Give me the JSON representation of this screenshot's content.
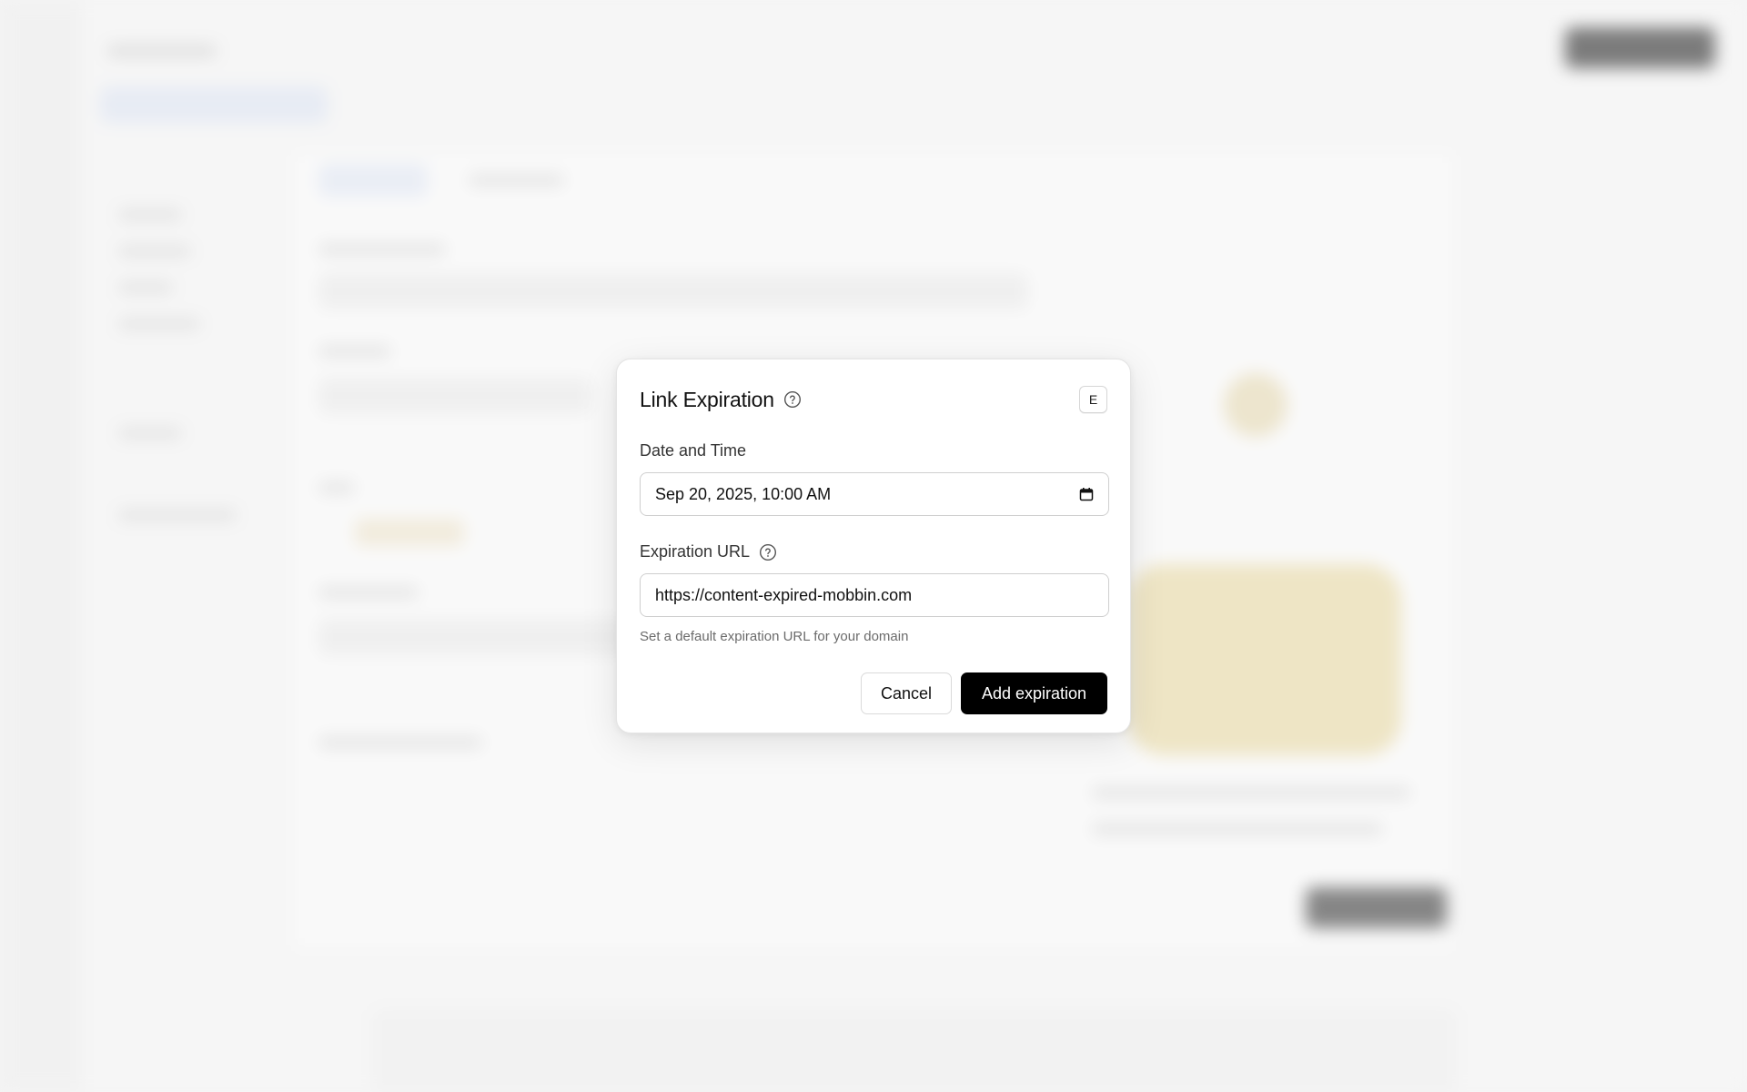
{
  "modal": {
    "title": "Link Expiration",
    "shortcut_key": "E",
    "date_field": {
      "label": "Date and Time",
      "value": "Sep 20, 2025, 10:00 AM"
    },
    "url_field": {
      "label": "Expiration URL",
      "value": "https://content-expired-mobbin.com",
      "hint": "Set a default expiration URL for your domain"
    },
    "cancel_label": "Cancel",
    "submit_label": "Add expiration"
  },
  "colors": {
    "primary_button": "#000000",
    "modal_background": "#ffffff",
    "backdrop": "#f4f4f4"
  },
  "icons": {
    "title_help": "help-circle-icon",
    "url_help": "help-circle-icon",
    "date_picker": "calendar-icon"
  }
}
